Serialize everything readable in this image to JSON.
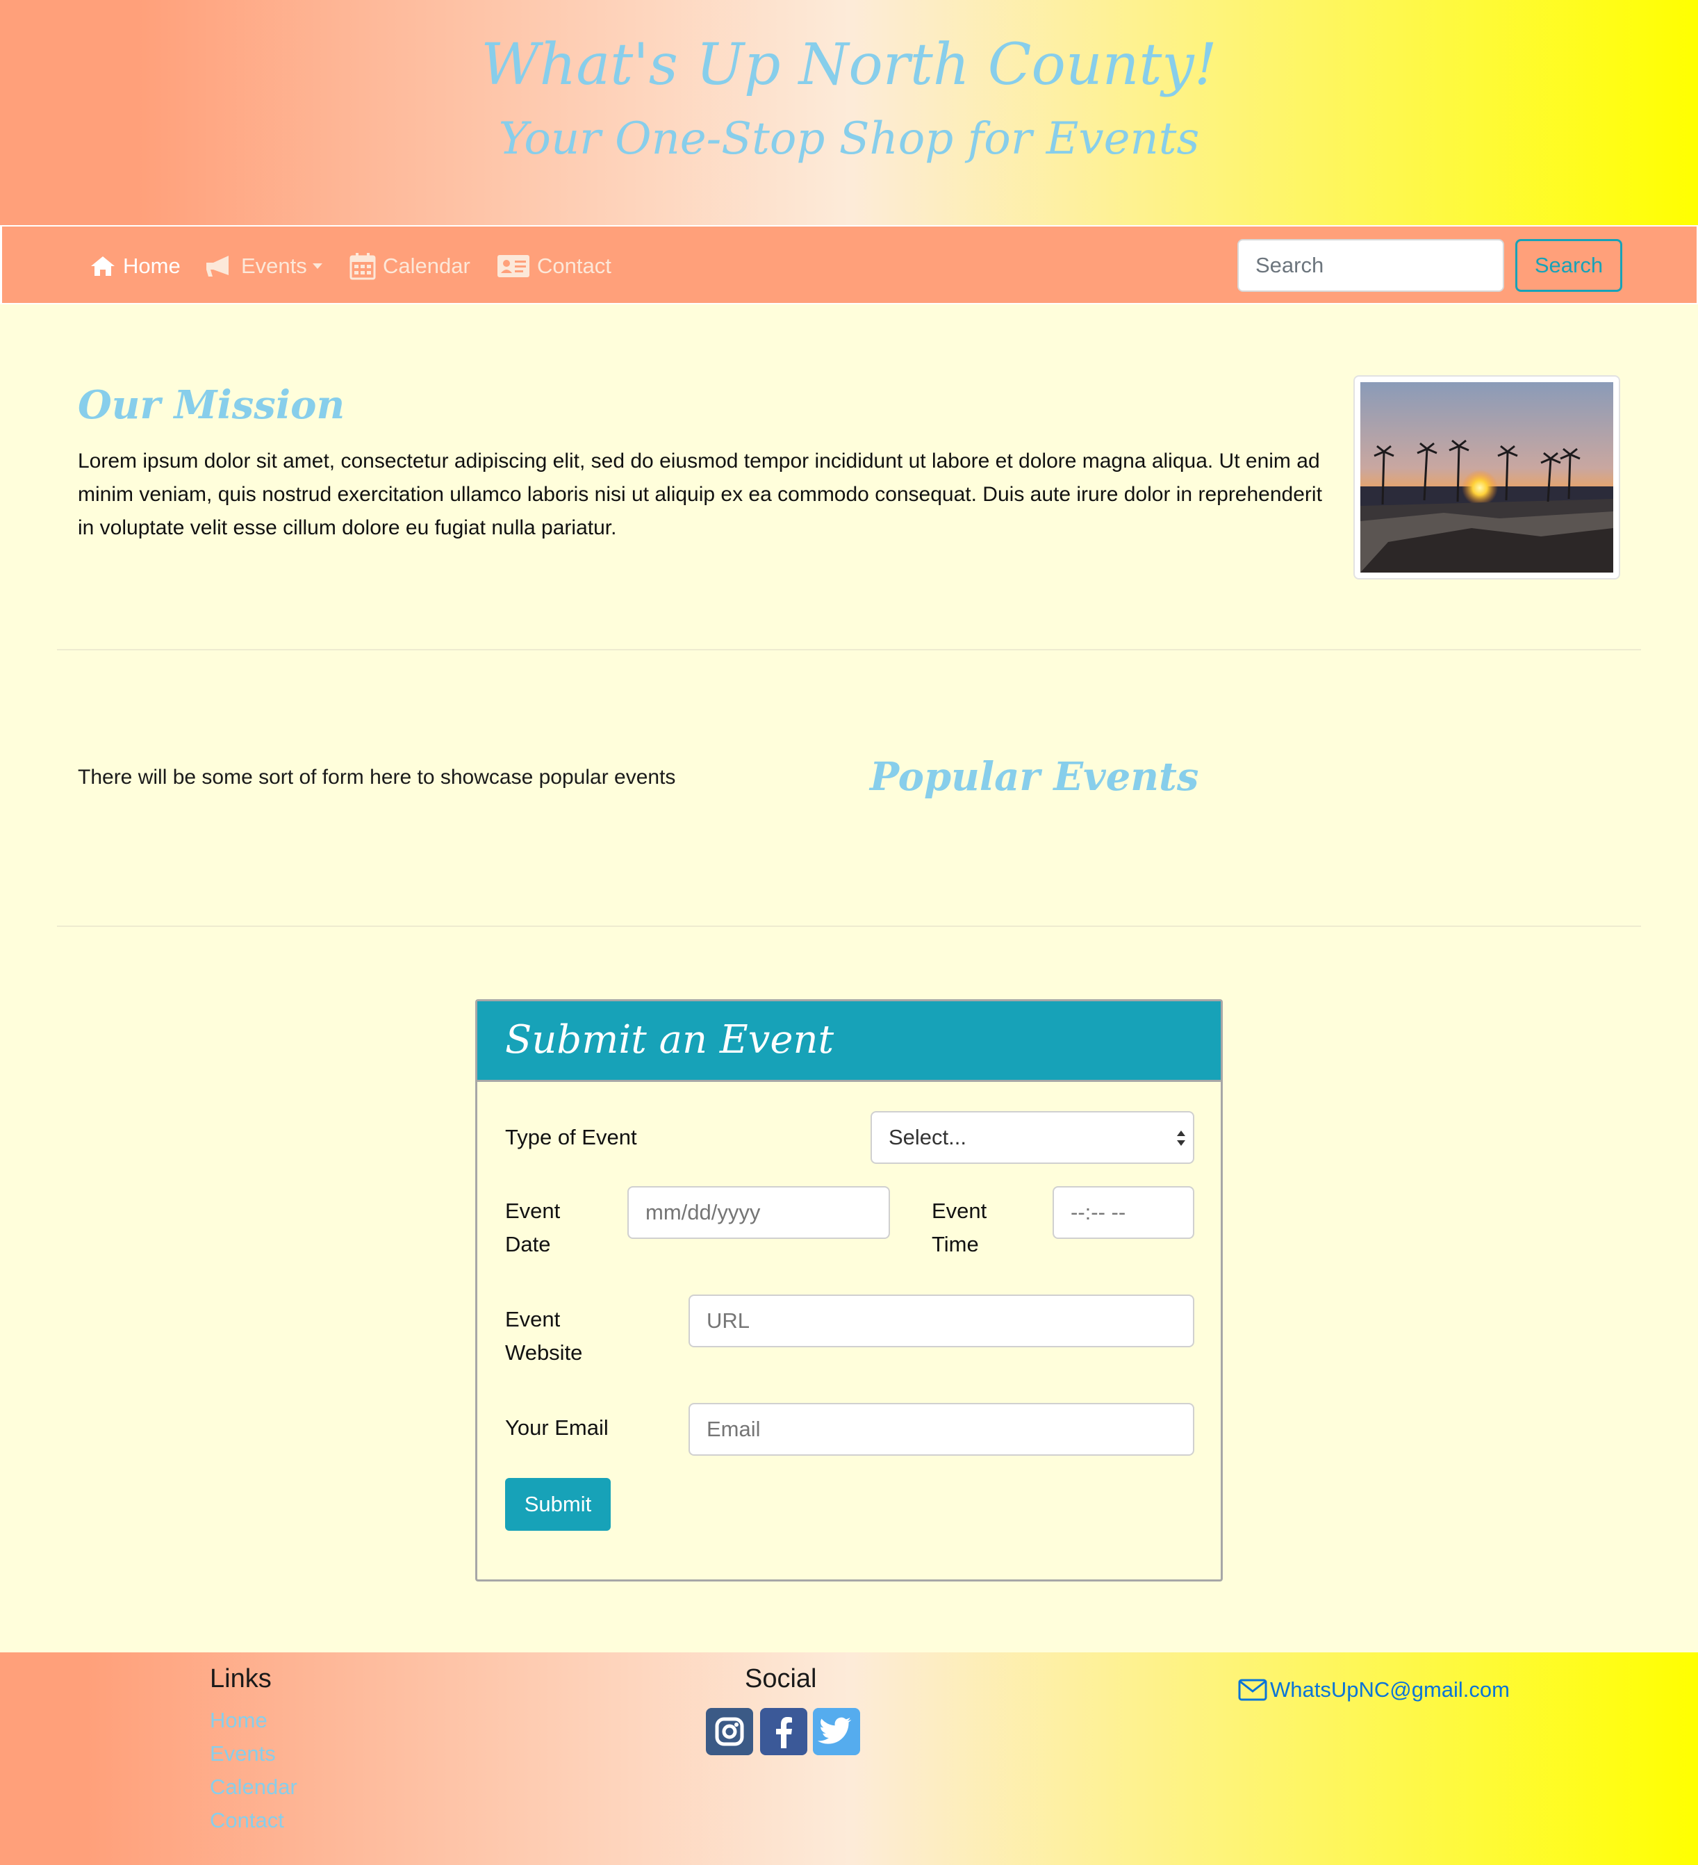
{
  "header": {
    "title": "What's Up North County!",
    "subtitle": "Your One-Stop Shop for Events"
  },
  "nav": {
    "items": [
      {
        "label": "Home",
        "icon": "home-icon",
        "active": true
      },
      {
        "label": "Events",
        "icon": "megaphone-icon",
        "dropdown": true
      },
      {
        "label": "Calendar",
        "icon": "calendar-icon"
      },
      {
        "label": "Contact",
        "icon": "contact-card-icon"
      }
    ],
    "search_placeholder": "Search",
    "search_button": "Search"
  },
  "mission": {
    "heading": "Our Mission",
    "text": "Lorem ipsum dolor sit amet, consectetur adipiscing elit, sed do eiusmod tempor incididunt ut labore et dolore magna aliqua. Ut enim ad minim veniam, quis nostrud exercitation ullamco laboris nisi ut aliquip ex ea commodo consequat. Duis aute irure dolor in reprehenderit in voluptate velit esse cillum dolore eu fugiat nulla pariatur."
  },
  "popular": {
    "text": "There will be some sort of form here to showcase popular events",
    "heading": "Popular Events"
  },
  "form": {
    "title": "Submit an Event",
    "type_label": "Type of Event",
    "type_value": "Select...",
    "date_label_1": "Event",
    "date_label_2": "Date",
    "date_placeholder": "mm/dd/yyyy",
    "time_label_1": "Event",
    "time_label_2": "Time",
    "time_placeholder": "--:-- --",
    "website_label_1": "Event",
    "website_label_2": "Website",
    "website_placeholder": "URL",
    "email_label": "Your Email",
    "email_placeholder": "Email",
    "submit": "Submit"
  },
  "footer": {
    "links_heading": "Links",
    "links": [
      "Home",
      "Events",
      "Calendar",
      "Contact"
    ],
    "social_heading": "Social",
    "social_icons": [
      "instagram-icon",
      "facebook-icon",
      "twitter-icon"
    ],
    "email": "WhatsUpNC@gmail.com"
  },
  "colors": {
    "accent": "#17a2b8",
    "heading": "#87ceeb",
    "nav": "#ffa07a",
    "page": "#fffedb"
  }
}
